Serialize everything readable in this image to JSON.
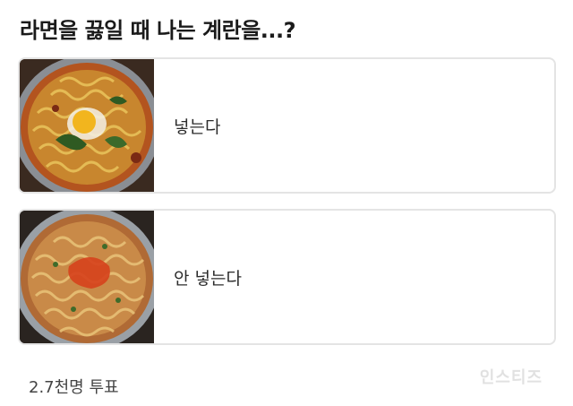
{
  "question": "라면을 끓일 때 나는 계란을...?",
  "options": [
    {
      "label": "넣는다",
      "image": "ramen-with-egg"
    },
    {
      "label": "안 넣는다",
      "image": "ramen-without-egg"
    }
  ],
  "votes_text": "2.7천명 투표",
  "watermark": "인스티즈",
  "colors": {
    "border": "#e4e4e4",
    "text": "#222222"
  }
}
